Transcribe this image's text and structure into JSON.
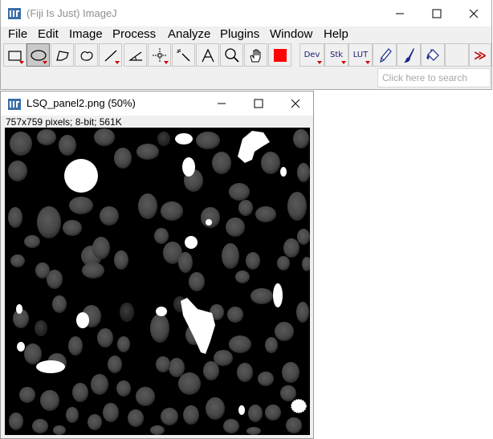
{
  "main_window": {
    "title": "(Fiji Is Just) ImageJ",
    "menu": [
      "File",
      "Edit",
      "Image",
      "Process",
      "Analyze",
      "Plugins",
      "Window",
      "Help"
    ],
    "toolbar": {
      "dev_label": "Dev",
      "stk_label": "Stk",
      "lut_label": "LUT",
      "more_label": "≫"
    },
    "search_placeholder": "Click here to search"
  },
  "image_window": {
    "title": "LSQ_panel2.png (50%)",
    "info": "757x759 pixels; 8-bit; 561K"
  },
  "colors": {
    "foreground_swatch": "#ff0000",
    "canvas_background": "#000000"
  }
}
